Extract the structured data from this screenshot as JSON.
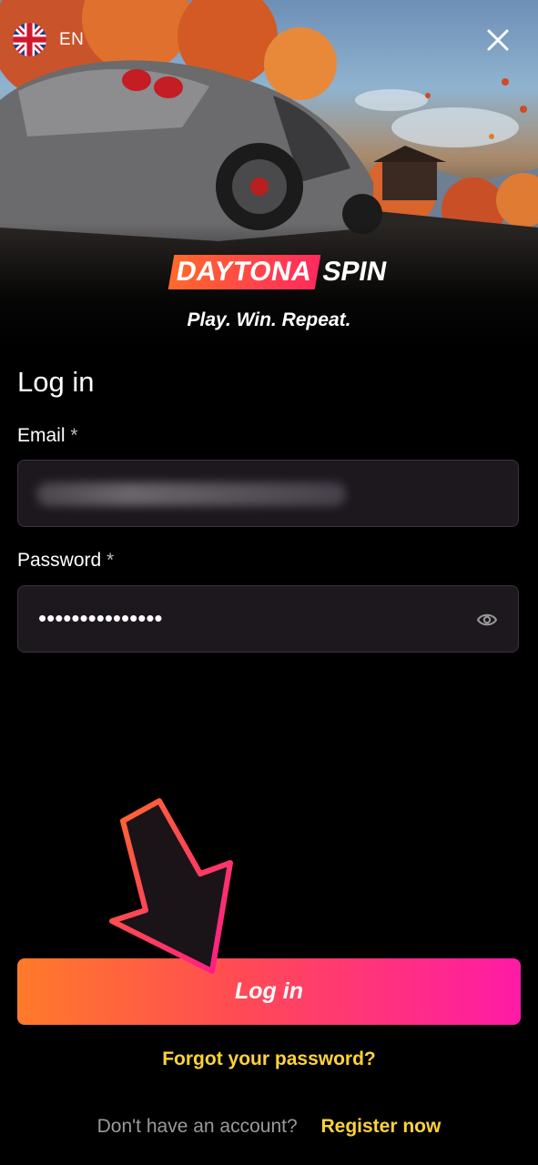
{
  "header": {
    "language_code": "EN",
    "brand_part1": "DAYTONA",
    "brand_part2": "SPIN",
    "tagline": "Play. Win. Repeat."
  },
  "icons": {
    "flag": "uk-flag-icon",
    "close": "close-icon",
    "password_toggle": "eye-icon"
  },
  "form": {
    "title": "Log in",
    "email_label": "Email",
    "required_mark": "*",
    "email_value": "",
    "password_label": "Password",
    "password_value": "•••••••••••••••",
    "submit_label": "Log in"
  },
  "links": {
    "forgot_password": "Forgot your password?",
    "no_account": "Don't have an account?",
    "register": "Register now"
  },
  "colors": {
    "accent_yellow": "#ffd23a",
    "button_gradient_start": "#ff7a2a",
    "button_gradient_end": "#ff1aa6",
    "input_bg": "#1d181e"
  }
}
